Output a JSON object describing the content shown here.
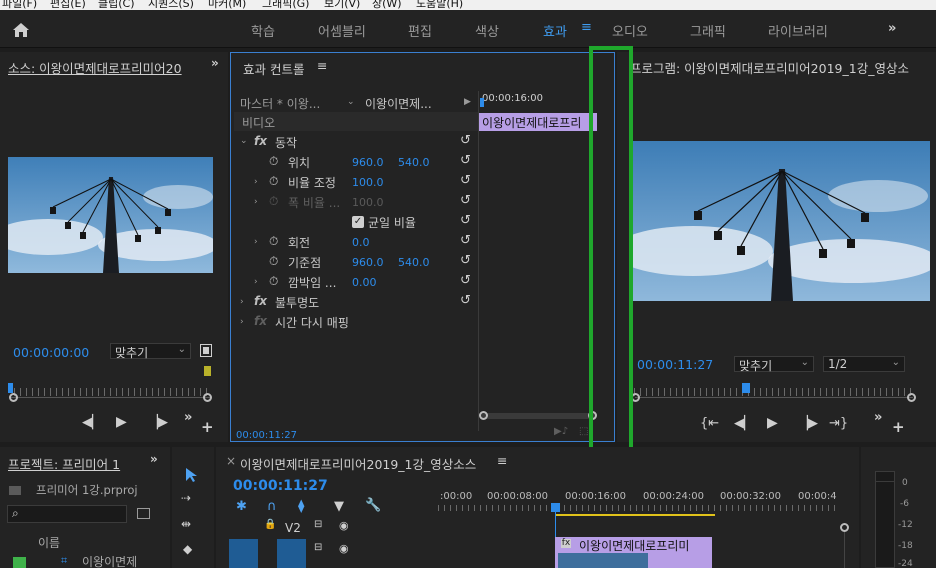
{
  "menubar": {
    "items": [
      "파일(F)",
      "편집(E)",
      "클립(C)",
      "시퀀스(S)",
      "마커(M)",
      "그래픽(G)",
      "보기(V)",
      "창(W)",
      "도움말(H)"
    ]
  },
  "workspaces": {
    "home_icon": "home-icon",
    "tabs": [
      "학습",
      "어셈블리",
      "편집",
      "색상",
      "효과",
      "오디오",
      "그래픽",
      "라이브러리"
    ],
    "active": "효과",
    "more": "»"
  },
  "source_monitor": {
    "title": "소스: 이왕이면제대로프리미어20",
    "more": "»",
    "timecode": "00:00:00:00",
    "fit": "맞추기"
  },
  "effect_controls": {
    "title": "효과 컨트롤",
    "menu": "≡",
    "master_label": "마스터 * 이왕...",
    "clip_label": "이왕이면제...",
    "section_video": "비디오",
    "timeline_time": "00:00:16:00",
    "clip_bar_label": "이왕이면제대로프리",
    "motion": "동작",
    "position_label": "위치",
    "position_x": "960.0",
    "position_y": "540.0",
    "scale_label": "비율 조정",
    "scale_value": "100.0",
    "scale_width_label": "폭 비율 ...",
    "scale_width_value": "100.0",
    "uniform_scale": "균일 비율",
    "rotation_label": "회전",
    "rotation_value": "0.0",
    "anchor_label": "기준점",
    "anchor_x": "960.0",
    "anchor_y": "540.0",
    "flicker_label": "깜박임 ...",
    "flicker_value": "0.00",
    "opacity": "불투명도",
    "time_remap": "시간 다시 매핑",
    "footer_time": "00:00:11:27"
  },
  "program_monitor": {
    "title": "프로그램: 이왕이면제대로프리미어2019_1강_영상소",
    "timecode": "00:00:11:27",
    "fit": "맞추기",
    "resolution": "1/2"
  },
  "project": {
    "title": "프로젝트: 프리미어 1",
    "more": "»",
    "file": "프리미어 1강.prproj",
    "col_name": "이름",
    "item": "이왕이면제"
  },
  "timeline": {
    "close": "×",
    "title": "이왕이면제대로프리미어2019_1강_영상소스",
    "menu": "≡",
    "timecode": "00:00:11:27",
    "ruler_labels": [
      ":00:00",
      "00:00:08:00",
      "00:00:16:00",
      "00:00:24:00",
      "00:00:32:00",
      "00:00:4"
    ],
    "track_v2": "V2",
    "clip_label": "이왕이면제대로프리미"
  },
  "audio_meter": {
    "labels": [
      "0",
      "-6",
      "-12",
      "-18",
      "-24"
    ]
  },
  "colors": {
    "accent_blue": "#2d8ceb",
    "highlight_green": "#1fa82c",
    "clip_purple": "#b79ee6",
    "playhead_yellow": "#e0c21a"
  }
}
